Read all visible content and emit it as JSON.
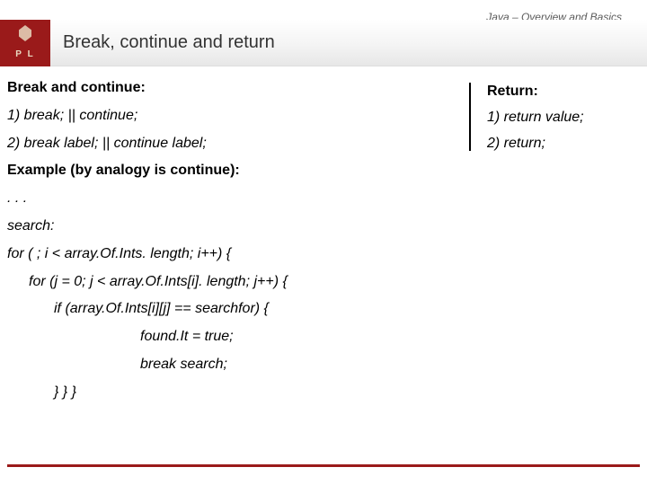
{
  "chapter": "Java – Overview and Basics",
  "logo": {
    "letters": "P   L"
  },
  "title": "Break, continue and return",
  "left": {
    "heading": "Break and continue:",
    "item1": "1) break;  || continue;",
    "item2": "2) break label; || continue label;",
    "example_heading": "Example (by analogy is continue):",
    "code": {
      "l0": ". . .",
      "l1": "search:",
      "l2": "for ( ; i < array.Of.Ints. length; i++) {",
      "l3": "for (j = 0; j < array.Of.Ints[i]. length; j++) {",
      "l4": "if (array.Of.Ints[i][j] == searchfor) {",
      "l5": "found.It = true;",
      "l6": "break search;",
      "l7": "} } }"
    }
  },
  "right": {
    "heading": "Return:",
    "item1": "1) return value;",
    "item2": "2) return;"
  }
}
